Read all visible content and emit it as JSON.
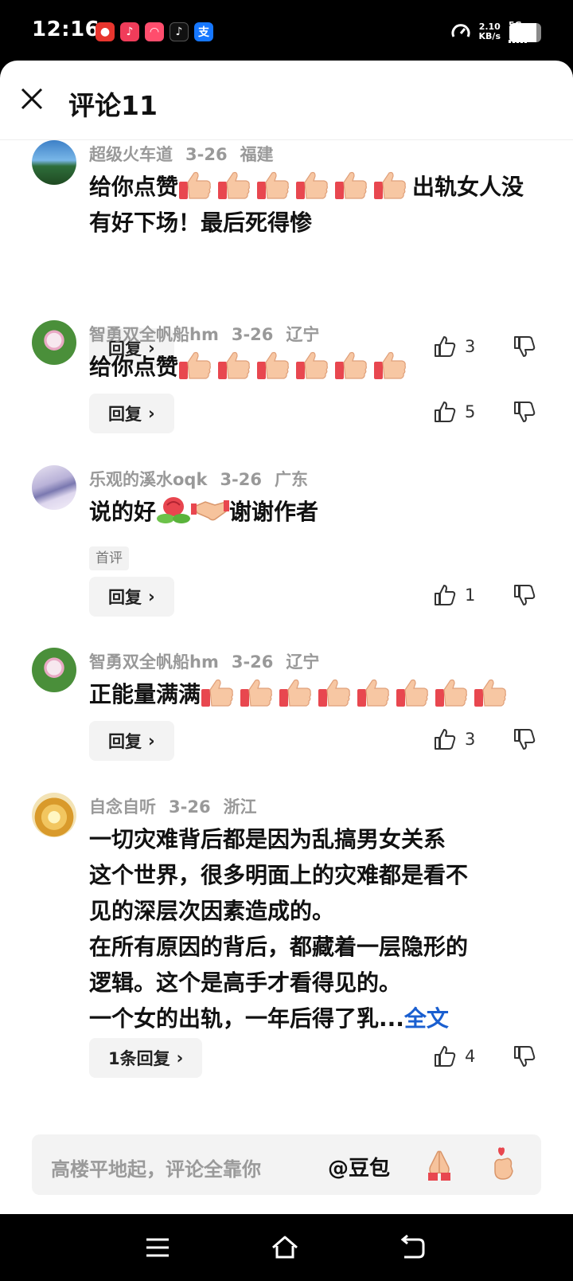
{
  "status_bar": {
    "time": "12:16",
    "speed_value": "2.10",
    "speed_unit": "KB/s",
    "network": "5G",
    "battery_percent": 85,
    "app_icons": [
      "app-icon-red",
      "douyin-lite-icon",
      "app-icon-pink",
      "douyin-icon",
      "alipay-icon"
    ]
  },
  "header": {
    "title": "评论11"
  },
  "comments": [
    {
      "user": "超级火车道",
      "date": "3-26",
      "location": "福建",
      "text_lead": "给你点赞",
      "thumbs_count": 6,
      "text_trail": "出轨女人没有好下场！最后死得惨",
      "reply_label": "回复",
      "likes": "3"
    },
    {
      "user": "智勇双全帆船hm",
      "date": "3-26",
      "location": "辽宁",
      "text_lead": "给你点赞",
      "thumbs_count": 6,
      "reply_label": "回复",
      "likes": "5"
    },
    {
      "user": "乐观的溪水oqk",
      "date": "3-26",
      "location": "广东",
      "text_lead": "说的好",
      "text_trail": "谢谢作者",
      "tag": "首评",
      "reply_label": "回复",
      "likes": "1"
    },
    {
      "user": "智勇双全帆船hm",
      "date": "3-26",
      "location": "辽宁",
      "text_lead": "正能量满满",
      "thumbs_count": 8,
      "reply_label": "回复",
      "likes": "3"
    },
    {
      "user": "自念自听",
      "date": "3-26",
      "location": "浙江",
      "lines": [
        "一切灾难背后都是因为乱搞男女关系",
        "这个世界，很多明面上的灾难都是看不",
        "见的深层次因素造成的。",
        "在所有原因的背后，都藏着一层隐形的",
        "逻辑。这个是高手才看得见的。",
        "一个女的出轨，一年后得了乳..."
      ],
      "more_label": "全文",
      "reply_label": "1条回复",
      "likes": "4"
    }
  ],
  "input_bar": {
    "placeholder": "高楼平地起，评论全靠你",
    "mention": "@豆包"
  },
  "colors": {
    "link": "#1a5fd0",
    "meta_gray": "#999999",
    "button_bg": "#f3f3f3"
  }
}
